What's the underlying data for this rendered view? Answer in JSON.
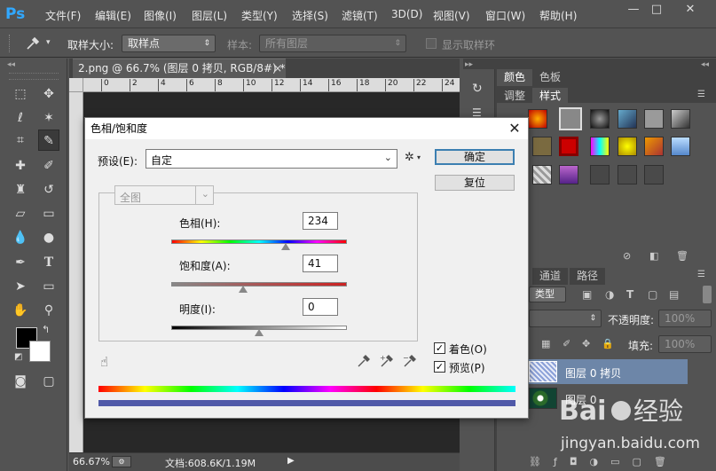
{
  "app": {
    "logo": "Ps"
  },
  "menu": [
    "文件(F)",
    "编辑(E)",
    "图像(I)",
    "图层(L)",
    "类型(Y)",
    "选择(S)",
    "滤镜(T)",
    "3D(D)",
    "视图(V)",
    "窗口(W)",
    "帮助(H)"
  ],
  "window_controls": {
    "minimize": "—",
    "restore": "□",
    "close": "✕"
  },
  "options_bar": {
    "sample_size_label": "取样大小:",
    "sample_size_value": "取样点",
    "sample_label": "样本:",
    "sample_value": "所有图层",
    "show_ring_label": "显示取样环"
  },
  "document": {
    "tab_title": "2.png @ 66.7% (图层 0 拷贝, RGB/8#) *",
    "tab_close": "×",
    "ruler_ticks": [
      "0",
      "2",
      "4",
      "6",
      "8",
      "10",
      "12",
      "14",
      "16",
      "18",
      "20",
      "22",
      "24"
    ],
    "zoom": "66.67%",
    "doc_info": "文档:608.6K/1.19M"
  },
  "panels": {
    "tabs_top": [
      "颜色",
      "色板"
    ],
    "tabs_mid": [
      "调整",
      "样式"
    ],
    "tabs_layers": [
      "通道",
      "路径"
    ],
    "kind_label": "类型",
    "opacity_label": "不透明度:",
    "opacity_value": "100%",
    "fill_label": "填充:",
    "fill_value": "100%",
    "layers": [
      {
        "name": "图层 0 拷贝",
        "selected": true
      },
      {
        "name": "图层 0",
        "selected": false
      }
    ]
  },
  "dialog": {
    "title": "色相/饱和度",
    "close": "✕",
    "preset_label": "预设(E):",
    "preset_value": "自定",
    "ok_label": "确定",
    "reset_label": "复位",
    "channel_value": "全图",
    "hue_label": "色相(H):",
    "hue_value": "234",
    "hue_fraction": 0.65,
    "saturation_label": "饱和度(A):",
    "saturation_value": "41",
    "saturation_fraction": 0.41,
    "lightness_label": "明度(I):",
    "lightness_value": "0",
    "lightness_fraction": 0.5,
    "colorize_label": "着色(O)",
    "colorize_checked": true,
    "preview_label": "预览(P)",
    "preview_checked": true
  },
  "colors": {
    "ps_blue": "#31a8ff",
    "result_bar": "#5059a8",
    "selected_layer": "#6d86a8"
  }
}
